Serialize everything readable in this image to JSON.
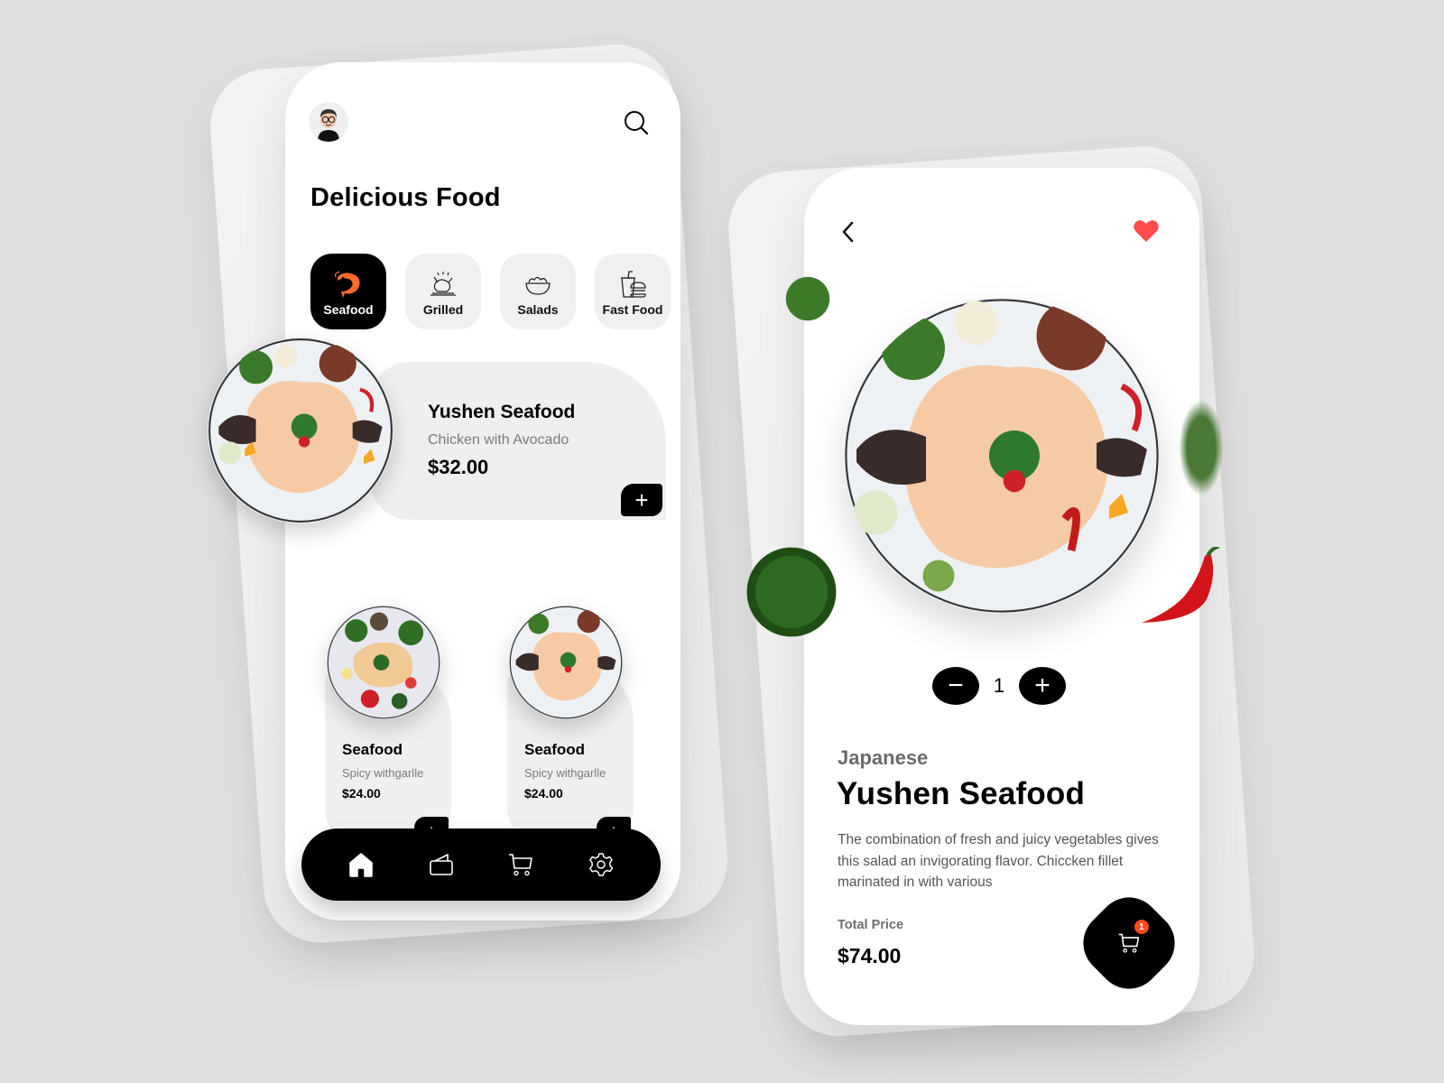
{
  "home": {
    "title": "Delicious Food",
    "categories": [
      {
        "label": "Seafood",
        "icon": "shrimp-icon",
        "active": true
      },
      {
        "label": "Grilled",
        "icon": "roast-chicken-icon",
        "active": false
      },
      {
        "label": "Salads",
        "icon": "salad-bowl-icon",
        "active": false
      },
      {
        "label": "Fast Food",
        "icon": "burger-drink-icon",
        "active": false
      }
    ],
    "featured": {
      "name": "Yushen Seafood",
      "subtitle": "Chicken with Avocado",
      "price": "$32.00",
      "add_label": "+"
    },
    "items": [
      {
        "name": "Seafood",
        "subtitle": "Spicy withgarlle",
        "price": "$24.00",
        "add_label": "+"
      },
      {
        "name": "Seafood",
        "subtitle": "Spicy withgarlle",
        "price": "$24.00",
        "add_label": "+"
      }
    ],
    "nav": [
      {
        "name": "home",
        "icon": "home-icon",
        "active": true
      },
      {
        "name": "wallet",
        "icon": "wallet-icon",
        "active": false
      },
      {
        "name": "cart",
        "icon": "cart-icon",
        "active": false
      },
      {
        "name": "settings",
        "icon": "gear-icon",
        "active": false
      }
    ]
  },
  "detail": {
    "cuisine": "Japanese",
    "title": "Yushen Seafood",
    "description": "The combination of fresh and juicy vegetables gives this salad an invigorating flavor. Chiccken fillet marinated in with various",
    "quantity": "1",
    "minus_label": "−",
    "plus_label": "+",
    "total_label": "Total Price",
    "total_price": "$74.00",
    "cart_badge": "1",
    "favorite": true
  },
  "colors": {
    "background": "#dedede",
    "accent": "#000000",
    "heart": "#ff4d4d",
    "shrimp": "#ff6a2b",
    "badge": "#ff4a1c",
    "card": "#efefef"
  }
}
